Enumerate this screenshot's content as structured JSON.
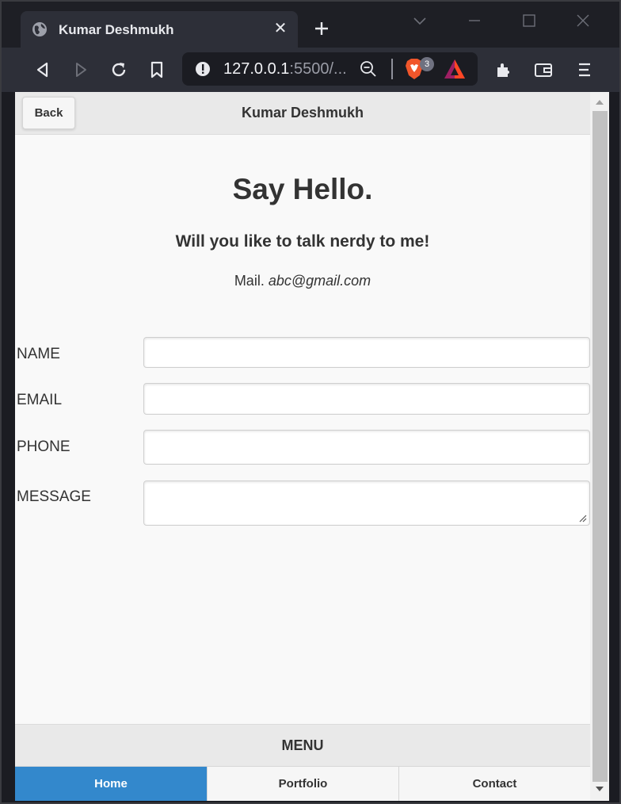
{
  "browser": {
    "tab_title": "Kumar Deshmukh",
    "url_host": "127.0.0.1",
    "url_rest": ":5500/...",
    "shields_badge_count": "3"
  },
  "page": {
    "back_label": "Back",
    "header_title": "Kumar Deshmukh",
    "hero_title": "Say Hello.",
    "hero_subtitle": "Will you like to talk nerdy to me!",
    "mail_prefix": "Mail.",
    "mail_address": "abc@gmail.com",
    "form": {
      "name_label": "NAME",
      "email_label": "EMAIL",
      "phone_label": "PHONE",
      "message_label": "MESSAGE",
      "name_value": "",
      "email_value": "",
      "phone_value": "",
      "message_value": ""
    },
    "menu_label": "MENU",
    "nav": [
      {
        "label": "Home",
        "active": true
      },
      {
        "label": "Portfolio",
        "active": false
      },
      {
        "label": "Contact",
        "active": false
      }
    ]
  },
  "colors": {
    "nav_active": "#3388cc",
    "browser_chrome": "#2d2f38"
  }
}
